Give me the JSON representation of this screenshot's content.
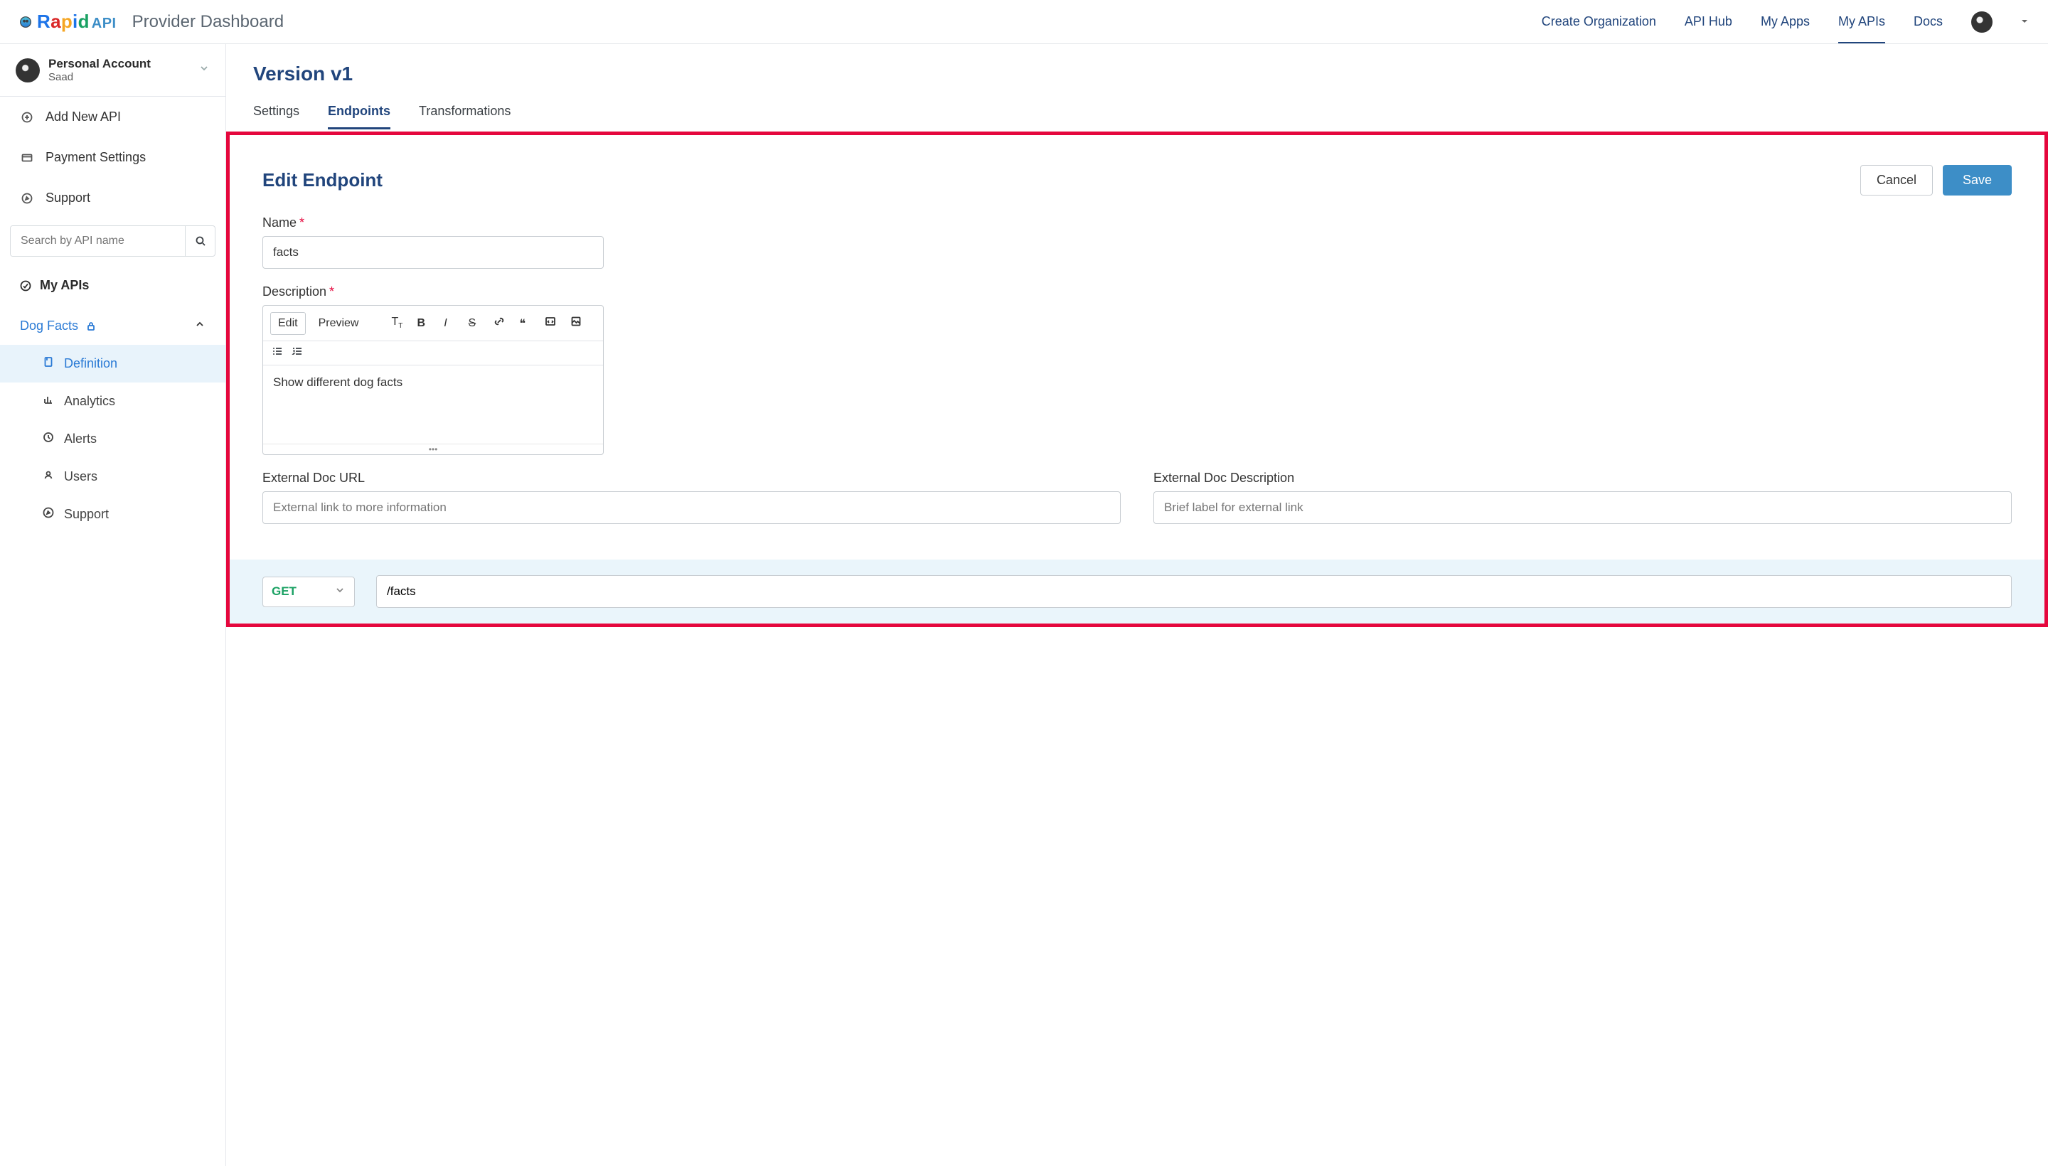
{
  "brand": "Rapid",
  "brand_suffix": "API",
  "dashboard_title": "Provider Dashboard",
  "header_nav": {
    "create_org": "Create Organization",
    "api_hub": "API Hub",
    "my_apps": "My Apps",
    "my_apis": "My APIs",
    "docs": "Docs"
  },
  "account": {
    "line1": "Personal Account",
    "line2": "Saad"
  },
  "sidebar": {
    "add_api": "Add New API",
    "payment": "Payment Settings",
    "support": "Support",
    "search_placeholder": "Search by API name",
    "section_my_apis": "My APIs",
    "current_api": "Dog Facts",
    "items": {
      "definition": "Definition",
      "analytics": "Analytics",
      "alerts": "Alerts",
      "users": "Users",
      "support2": "Support"
    }
  },
  "page": {
    "title": "Version v1",
    "tabs": {
      "settings": "Settings",
      "endpoints": "Endpoints",
      "transformations": "Transformations"
    }
  },
  "panel": {
    "title": "Edit Endpoint",
    "cancel": "Cancel",
    "save": "Save",
    "name_label": "Name",
    "name_value": "facts",
    "description_label": "Description",
    "editor_tabs": {
      "edit": "Edit",
      "preview": "Preview"
    },
    "description_value": "Show different dog facts",
    "ext_url_label": "External Doc URL",
    "ext_url_placeholder": "External link to more information",
    "ext_desc_label": "External Doc Description",
    "ext_desc_placeholder": "Brief label for external link",
    "method": "GET",
    "path": "/facts"
  }
}
